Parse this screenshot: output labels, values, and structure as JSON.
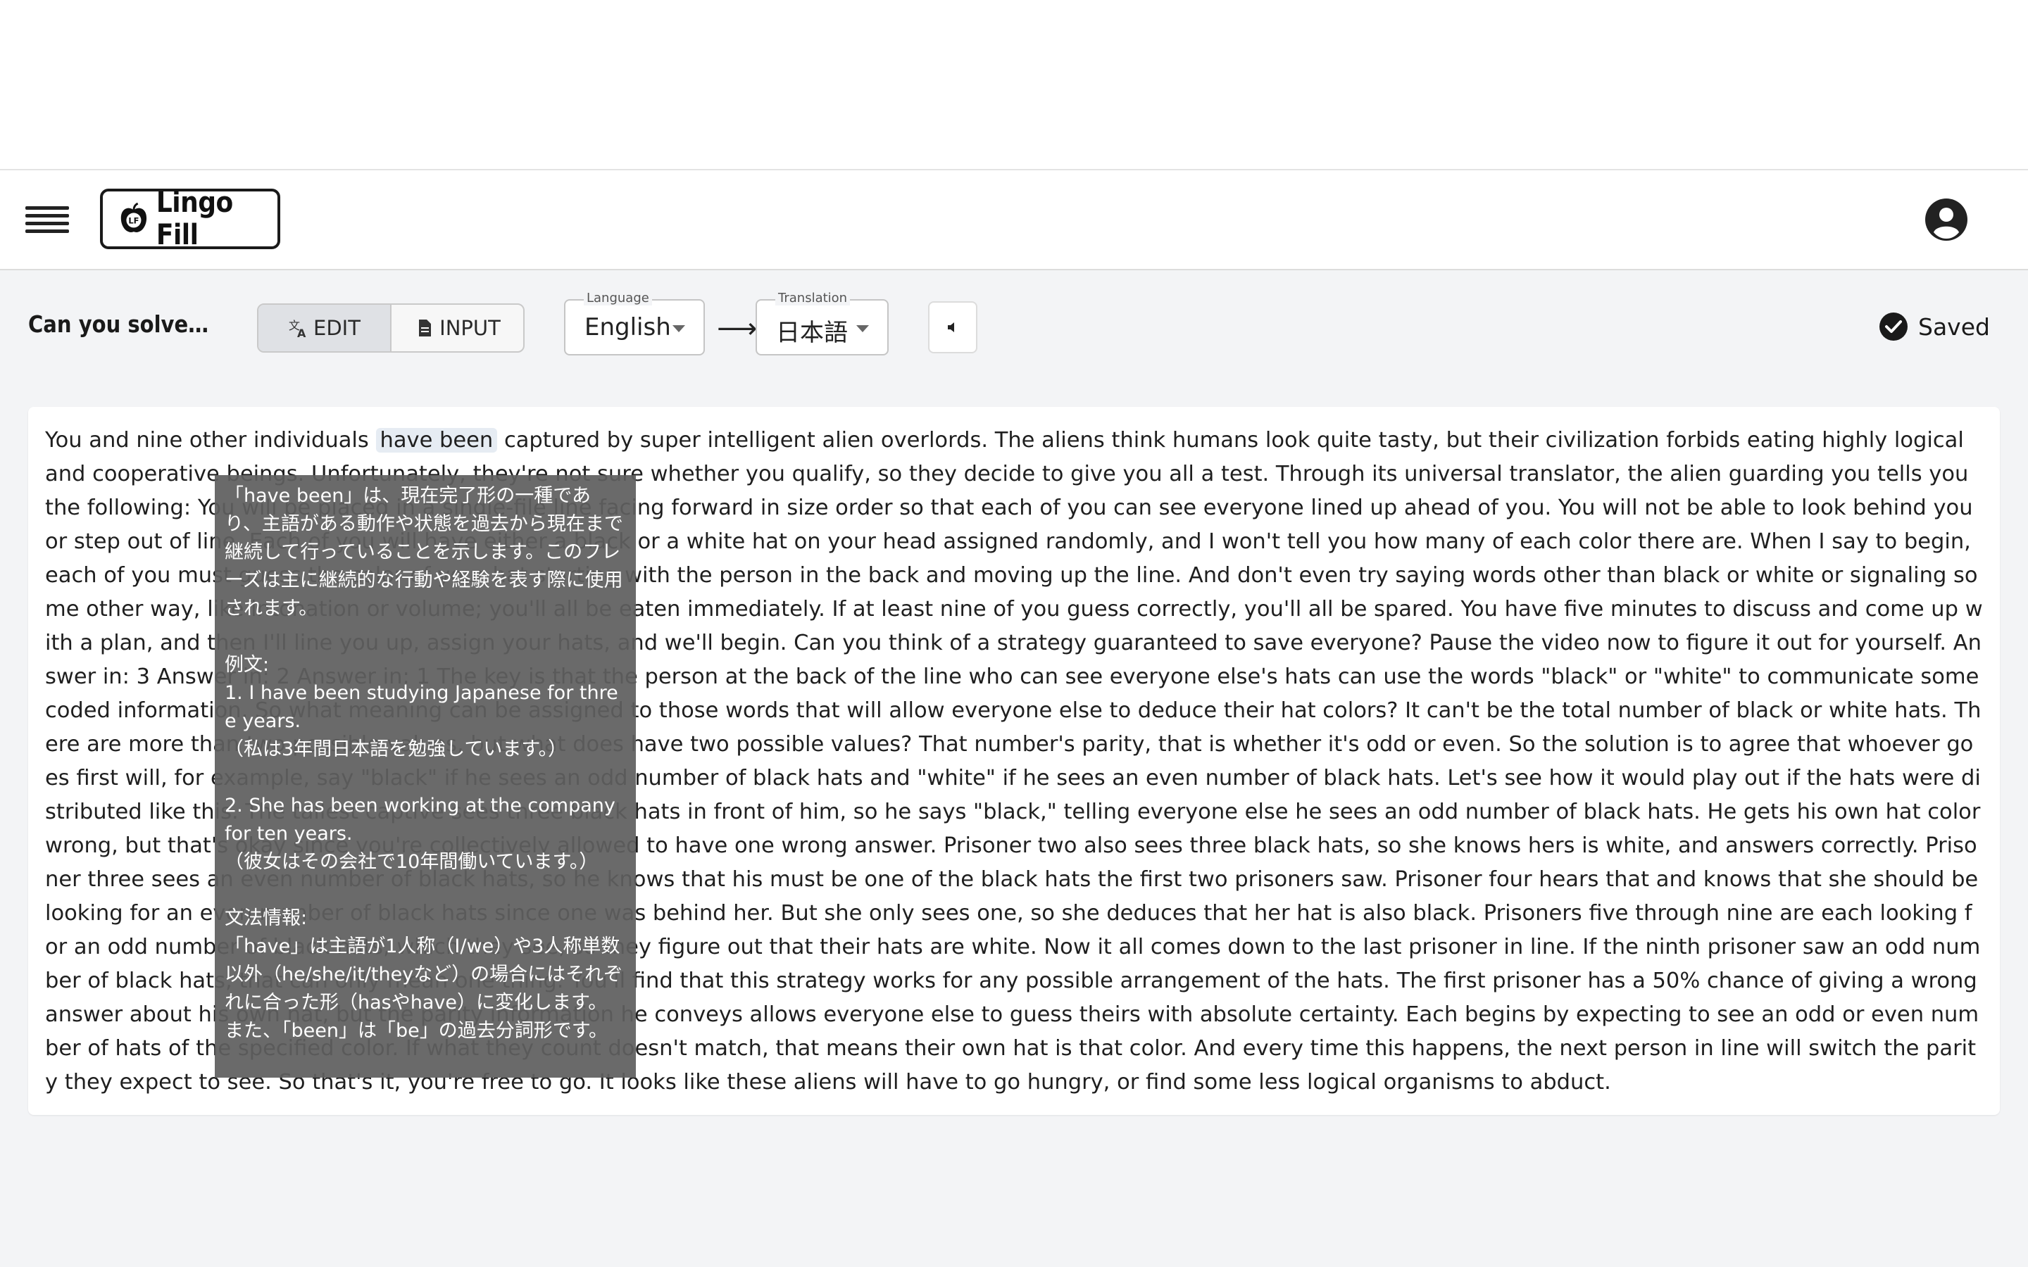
{
  "app": {
    "name": "Lingo Fill"
  },
  "toolbar": {
    "title": "Can you solve the pr...",
    "modes": [
      {
        "label": "EDIT",
        "icon": "translate-icon",
        "active": true
      },
      {
        "label": "INPUT",
        "icon": "document-icon",
        "active": false
      }
    ],
    "language": {
      "label": "Language",
      "value": "English"
    },
    "arrow": "⟶",
    "translation": {
      "label": "Translation",
      "value": "日本語"
    },
    "status": "Saved"
  },
  "passage": {
    "before": "You and nine other individuals ",
    "highlight": "have been",
    "after": " captured by super intelligent alien overlords. The aliens think humans look quite tasty, but their civilization forbids eating highly logical and cooperative beings. Unfortunately, they're not sure whether you qualify, so they decide to give you all a test. Through its universal translator, the alien guarding you tells you the following: You will be placed in a single-file line facing forward in size order so that each of you can see everyone lined up ahead of you. You will not be able to look behind you or step out of line. Each of you will have either a black or a white hat on your head assigned randomly, and I won't tell you how many of each color there are. When I say to begin, each of you must guess the color of your hat starting with the person in the back and moving up the line. And don't even try saying words other than black or white or signaling some other way, like intonation or volume; you'll all be eaten immediately. If at least nine of you guess correctly, you'll all be spared. You have five minutes to discuss and come up with a plan, and then I'll line you up, assign your hats, and we'll begin. Can you think of a strategy guaranteed to save everyone? Pause the video now to figure it out for yourself. Answer in: 3 Answer in: 2 Answer in: 1 The key is that the person at the back of the line who can see everyone else's hats can use the words \"black\" or \"white\" to communicate some coded information. So what meaning can be assigned to those words that will allow everyone else to deduce their hat colors? It can't be the total number of black or white hats. There are more than two possible values, but what does have two possible values? That number's parity, that is whether it's odd or even. So the solution is to agree that whoever goes first will, for example, say \"black\" if he sees an odd number of black hats and \"white\" if he sees an even number of black hats. Let's see how it would play out if the hats were distributed like this. The tallest captive sees three black hats in front of him, so he says \"black,\" telling everyone else he sees an odd number of black hats. He gets his own hat color wrong, but that's okay since you're collectively allowed to have one wrong answer. Prisoner two also sees three black hats, so she knows hers is white, and answers correctly. Prisoner three sees an even number of black hats, so he knows that his must be one of the black hats the first two prisoners saw. Prisoner four hears that and knows that she should be looking for an even number of black hats since one was behind her. But she only sees one, so she deduces that her hat is also black. Prisoners five through nine are each looking for an odd number of black hats, which they see, so they figure out that their hats are white. Now it all comes down to the last prisoner in line. If the ninth prisoner saw an odd number of black hats, that can only mean one thing. You'll find that this strategy works for any possible arrangement of the hats. The first prisoner has a 50% chance of giving a wrong answer about his own hat, but the parity information he conveys allows everyone else to guess theirs with absolute certainty. Each begins by expecting to see an odd or even number of hats of the specified color. If what they count doesn't match, that means their own hat is that color. And every time this happens, the next person in line will switch the parity they expect to see. So that's it, you're free to go. It looks like these aliens will have to go hungry, or find some less logical organisms to abduct."
  },
  "tooltip": {
    "text": "「have been」は、現在完了形の一種であり、主語がある動作や状態を過去から現在まで継続して行っていることを示します。このフレーズは主に継続的な行動や経験を表す際に使用されます。\n\n例文:\n1. I have been studying Japanese for three years.\n（私は3年間日本語を勉強しています。）\n\n2. She has been working at the company for ten years.\n（彼女はその会社で10年間働いています。）\n\n文法情報:\n「have」は主語が1人称（I/we）や3人称単数以外（he/she/it/theyなど）の場合にはそれぞれに合った形（hasやhave）に変化します。また、「been」は「be」の過去分詞形です。"
  }
}
